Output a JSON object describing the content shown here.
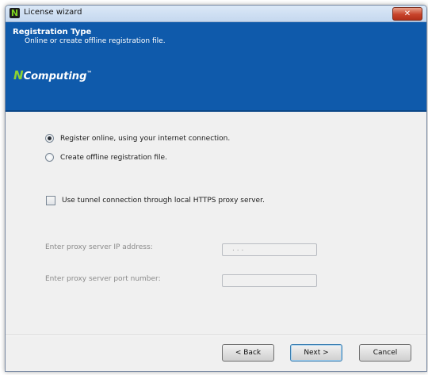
{
  "window": {
    "title": "License wizard",
    "close_symbol": "✕",
    "app_icon_symbol": "N"
  },
  "header": {
    "title": "Registration Type",
    "subtitle": "Online or create offline registration file.",
    "logo_n": "N",
    "logo_text": "Computing",
    "logo_tm": "™"
  },
  "options": {
    "register_online": {
      "label": "Register online, using your internet connection.",
      "checked": true
    },
    "create_offline": {
      "label": "Create offline registration file.",
      "checked": false
    },
    "use_tunnel": {
      "label": "Use tunnel connection through local HTTPS proxy server.",
      "checked": false
    }
  },
  "proxy": {
    "ip_label": "Enter proxy server IP address:",
    "ip_value": ".   .   .",
    "port_label": "Enter proxy server port number:",
    "port_value": ""
  },
  "buttons": {
    "back": "< Back",
    "next": "Next >",
    "cancel": "Cancel"
  },
  "colors": {
    "header_bg": "#0f5aab",
    "logo_accent": "#8cd230",
    "close_red": "#c7432b"
  }
}
